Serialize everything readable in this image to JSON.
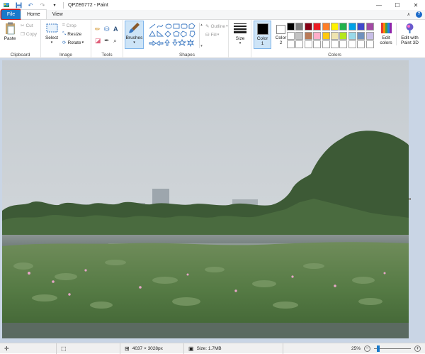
{
  "window": {
    "title": "QPZE6772 - Paint",
    "minimize_glyph": "—",
    "maximize_glyph": "☐",
    "close_glyph": "✕"
  },
  "tabs": {
    "file": "File",
    "home": "Home",
    "view": "View",
    "help": "?"
  },
  "clipboard": {
    "paste": "Paste",
    "cut": "Cut",
    "copy": "Copy",
    "label": "Clipboard"
  },
  "image": {
    "select": "Select",
    "crop": "Crop",
    "resize": "Resize",
    "rotate": "Rotate",
    "label": "Image"
  },
  "tools": {
    "label": "Tools",
    "text_tool": "A"
  },
  "brushes": {
    "label": "Brushes"
  },
  "shapes": {
    "outline": "Outline",
    "fill": "Fill",
    "label": "Shapes"
  },
  "size": {
    "label": "Size"
  },
  "colors": {
    "color1": "Color\n1",
    "color1_l1": "Color",
    "color1_l2": "1",
    "color2_l1": "Color",
    "color2_l2": "2",
    "edit_l1": "Edit",
    "edit_l2": "colors",
    "paint3d_l1": "Edit with",
    "paint3d_l2": "Paint 3D",
    "label": "Colors",
    "palette_row1": [
      "#000000",
      "#7f7f7f",
      "#880015",
      "#ed1c24",
      "#ff7f27",
      "#fff200",
      "#22b14c",
      "#00a2e8",
      "#3f48cc",
      "#a349a4"
    ],
    "palette_row2": [
      "#ffffff",
      "#c3c3c3",
      "#b97a57",
      "#ffaec9",
      "#ffc90e",
      "#efe4b0",
      "#b5e61d",
      "#99d9ea",
      "#7092be",
      "#c8bfe7"
    ],
    "color1_value": "#000000",
    "color2_value": "#ffffff"
  },
  "status": {
    "dimensions": "4037 × 3028px",
    "size": "Size: 1.7MB",
    "zoom": "25%"
  }
}
